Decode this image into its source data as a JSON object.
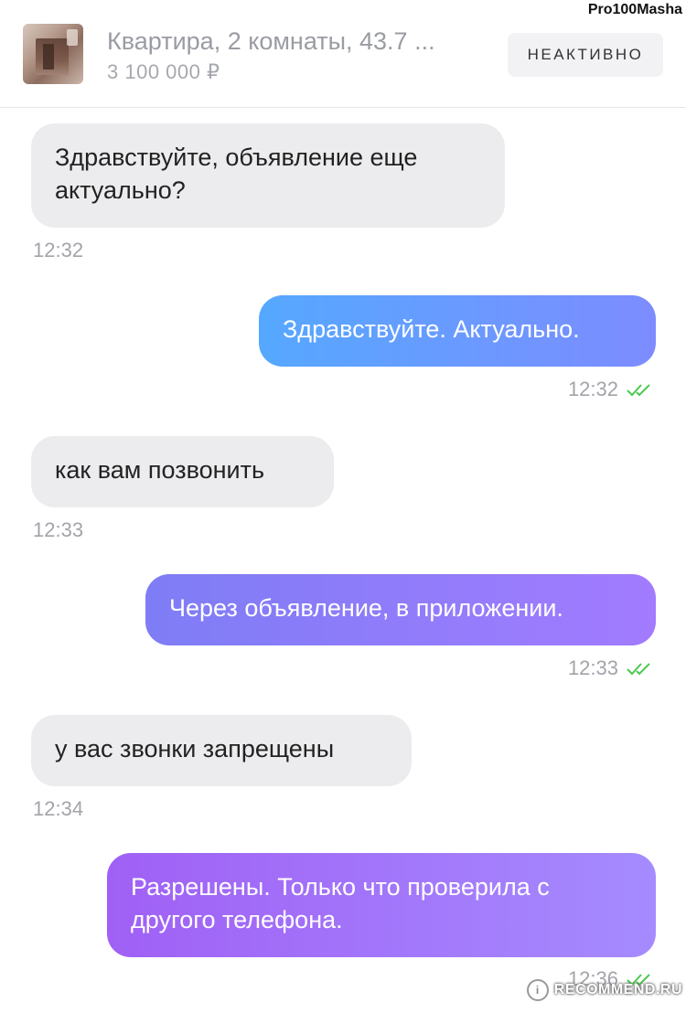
{
  "header": {
    "listing_title": "Квартира, 2 комнаты, 43.7 ...",
    "listing_price": "3 100 000 ₽",
    "status": "НЕАКТИВНО",
    "username_watermark": "Pro100Masha"
  },
  "messages": [
    {
      "direction": "incoming",
      "text": "Здравствуйте, объявление еще актуально?",
      "time": "12:32"
    },
    {
      "direction": "outgoing",
      "text": "Здравствуйте. Актуально.",
      "time": "12:32",
      "read": true
    },
    {
      "direction": "incoming",
      "text": "как вам позвонить",
      "time": "12:33"
    },
    {
      "direction": "outgoing",
      "text": "Через объявление, в приложении.",
      "time": "12:33",
      "read": true
    },
    {
      "direction": "incoming",
      "text": "у вас звонки запрещены",
      "time": "12:34"
    },
    {
      "direction": "outgoing",
      "text": "Разрешены. Только что проверила с другого телефона.",
      "time": "12:36",
      "read": true
    }
  ],
  "colors": {
    "incoming_bubble": "#ececee",
    "outgoing_gradient_1_start": "#55a8ff",
    "outgoing_gradient_1_end": "#7d8cff",
    "outgoing_gradient_2_start": "#7e7df5",
    "outgoing_gradient_2_end": "#a27bff",
    "outgoing_gradient_3_start": "#a060f5",
    "outgoing_gradient_3_end": "#a58bff",
    "read_check": "#4cc94f"
  },
  "watermark": {
    "site": "RECOMMEND.RU"
  }
}
